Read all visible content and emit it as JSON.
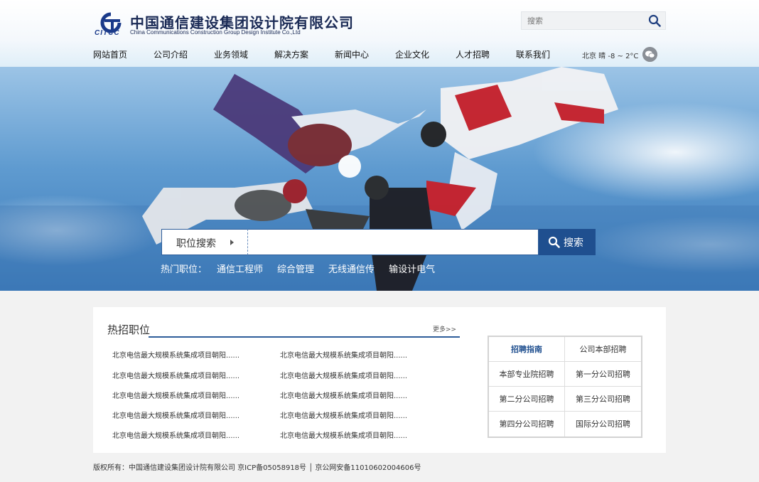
{
  "header": {
    "company_cn": "中国通信建设集团设计院有限公司",
    "company_en": "China Communications Construction  Group Design Institute Co.,Ltd",
    "logo_abbr": "CITCC",
    "search_placeholder": "搜索",
    "nav": [
      "网站首页",
      "公司介绍",
      "业务领域",
      "解决方案",
      "新闻中心",
      "企业文化",
      "人才招聘",
      "联系我们"
    ],
    "weather": "北京 晴 -8 ~ 2°C"
  },
  "banner": {
    "search_label": "职位搜索",
    "search_button": "搜索",
    "hot_label": "热门职位：",
    "hot_jobs": [
      "通信工程师",
      "综合管理",
      "无线通信传",
      "输设计电气"
    ]
  },
  "content": {
    "section_title": "热招职位",
    "more": "更多>>",
    "jobs_left": [
      "北京电信最大规模系统集成项目朝阳......",
      "北京电信最大规模系统集成项目朝阳......",
      "北京电信最大规模系统集成项目朝阳......",
      "北京电信最大规模系统集成项目朝阳......",
      "北京电信最大规模系统集成项目朝阳......"
    ],
    "jobs_right": [
      "北京电信最大规模系统集成项目朝阳......",
      "北京电信最大规模系统集成项目朝阳......",
      "北京电信最大规模系统集成项目朝阳......",
      "北京电信最大规模系统集成项目朝阳......",
      "北京电信最大规模系统集成项目朝阳......"
    ],
    "links": [
      "招聘指南",
      "公司本部招聘",
      "本部专业院招聘",
      "第一分公司招聘",
      "第二分公司招聘",
      "第三分公司招聘",
      "第四分公司招聘",
      "国际分公司招聘"
    ]
  },
  "footer": {
    "text": "版权所有：中国通信建设集团设计院有限公司 京ICP备05058918号 │ 京公网安备11010602004606号"
  },
  "colors": {
    "brand": "#1f4f8f",
    "nav_text": "#111111",
    "panel_bg": "#ffffff"
  }
}
